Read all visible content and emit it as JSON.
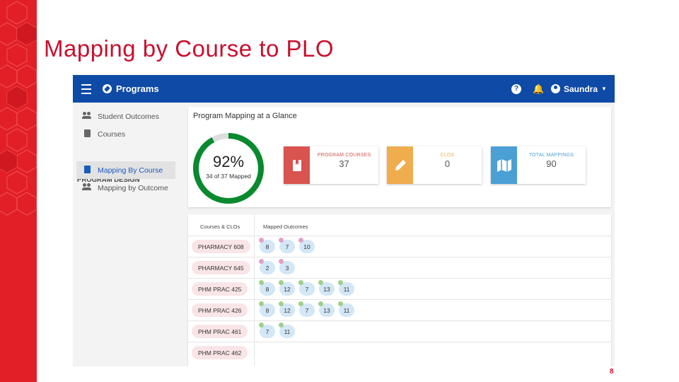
{
  "slide": {
    "title": "Mapping by Course to PLO",
    "page_number": "8",
    "accent_color": "#c8102e",
    "band_color": "#e21f26"
  },
  "app": {
    "topbar": {
      "brand": "Programs",
      "user": "Saundra",
      "color": "#0e4aa6",
      "help_icon": "question-circle-icon",
      "bell_icon": "bell-icon"
    },
    "sidebar": {
      "items_top": [
        {
          "label": "Student Outcomes",
          "icon": "people-icon"
        },
        {
          "label": "Courses",
          "icon": "book-icon"
        }
      ],
      "section_heading": "PROGRAM DESIGN",
      "items_design": [
        {
          "label": "Mapping By Course",
          "icon": "book-icon",
          "active": true
        },
        {
          "label": "Mapping by Outcome",
          "icon": "people-icon",
          "active": false
        }
      ]
    },
    "glance": {
      "title": "Program Mapping at a Glance",
      "progress_percent_label": "92%",
      "progress_fraction": 0.92,
      "progress_sub": "34 of 37 Mapped",
      "progress_color": "#0a8a2e",
      "stats": [
        {
          "label": "PROGRAM COURSES",
          "value": "37",
          "color": "#d9534f",
          "icon": "book-icon"
        },
        {
          "label": "CLOS",
          "value": "0",
          "color": "#f0ad4e",
          "icon": "pencil-icon"
        },
        {
          "label": "TOTAL MAPPINGS",
          "value": "90",
          "color": "#4a9fd5",
          "icon": "map-icon"
        }
      ]
    },
    "table": {
      "headers": [
        "Courses & CLOs",
        "Mapped Outcomes"
      ],
      "rows": [
        {
          "course": "PHARMACY 608",
          "outcomes": [
            {
              "v": "8",
              "dot": "#e3a0c6"
            },
            {
              "v": "7",
              "dot": "#e3a0c6"
            },
            {
              "v": "10",
              "dot": "#e3a0c6"
            }
          ]
        },
        {
          "course": "PHARMACY 645",
          "outcomes": [
            {
              "v": "2",
              "dot": "#e3a0c6"
            },
            {
              "v": "3",
              "dot": "#e3a0c6"
            }
          ]
        },
        {
          "course": "PHM PRAC 425",
          "outcomes": [
            {
              "v": "8",
              "dot": "#9ed08a"
            },
            {
              "v": "12",
              "dot": "#9ed08a"
            },
            {
              "v": "7",
              "dot": "#9ed08a"
            },
            {
              "v": "13",
              "dot": "#9ed08a"
            },
            {
              "v": "11",
              "dot": "#9ed08a"
            }
          ]
        },
        {
          "course": "PHM PRAC 426",
          "outcomes": [
            {
              "v": "8",
              "dot": "#9ed08a"
            },
            {
              "v": "12",
              "dot": "#9ed08a"
            },
            {
              "v": "7",
              "dot": "#9ed08a"
            },
            {
              "v": "13",
              "dot": "#9ed08a"
            },
            {
              "v": "11",
              "dot": "#9ed08a"
            }
          ]
        },
        {
          "course": "PHM PRAC 461",
          "outcomes": [
            {
              "v": "7",
              "dot": "#9ed08a"
            },
            {
              "v": "11",
              "dot": "#9ed08a"
            }
          ]
        },
        {
          "course": "PHM PRAC 462",
          "outcomes": []
        }
      ]
    }
  }
}
